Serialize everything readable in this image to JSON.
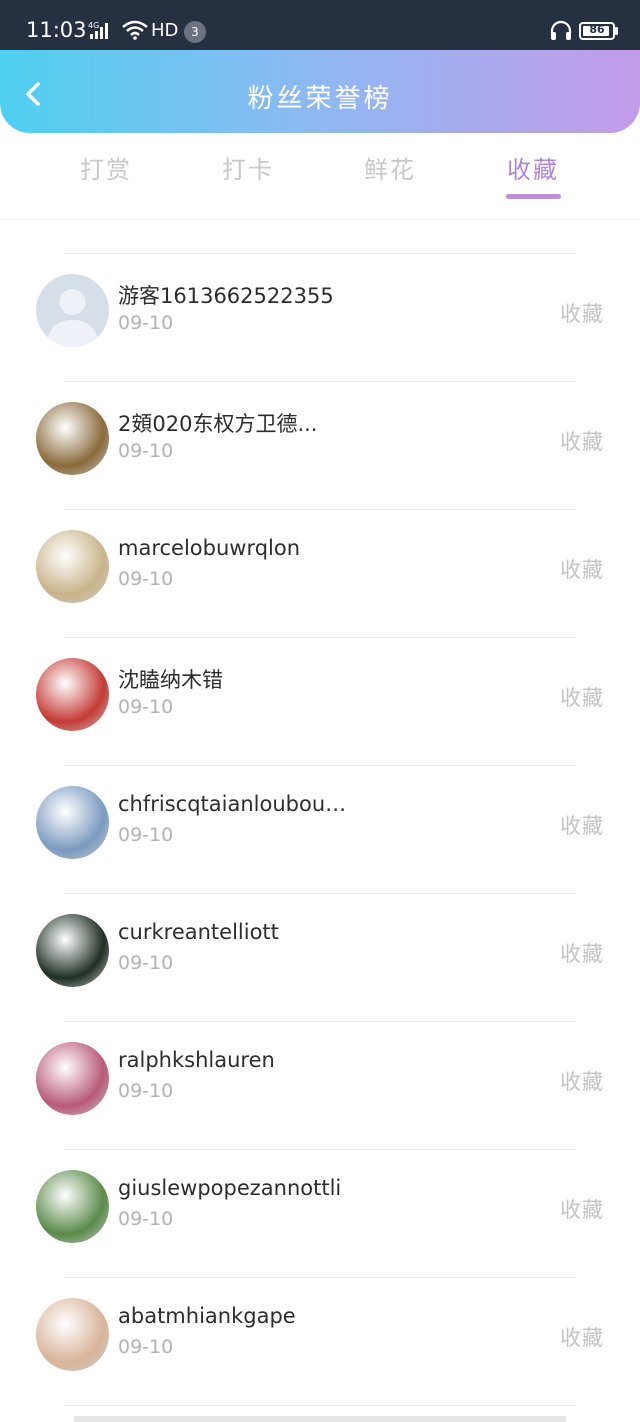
{
  "status_bar": {
    "time": "11:03",
    "network": "4G",
    "hd": "HD",
    "notification_count": "3",
    "battery": "86"
  },
  "header": {
    "title": "粉丝荣誉榜"
  },
  "tabs": [
    {
      "label": "打赏",
      "active": false
    },
    {
      "label": "打卡",
      "active": false
    },
    {
      "label": "鲜花",
      "active": false
    },
    {
      "label": "收藏",
      "active": true
    }
  ],
  "list": {
    "items": [
      {
        "name": "",
        "date": "09-10",
        "action": "收藏",
        "avatar_color": "#9fc4d8"
      },
      {
        "name": "游客1613662522355",
        "date": "09-10",
        "action": "收藏",
        "avatar_color": "#d3dbea"
      },
      {
        "name": "2頞020东权方卫德...",
        "date": "09-10",
        "action": "收藏",
        "avatar_color": "#8a6a3a"
      },
      {
        "name": "marcelobuwrqlon",
        "date": "09-10",
        "action": "收藏",
        "avatar_color": "#c9b48a"
      },
      {
        "name": "沈瞌纳木错",
        "date": "09-10",
        "action": "收藏",
        "avatar_color": "#c43a34"
      },
      {
        "name": "chfriscqtaianlouboutin",
        "date": "09-10",
        "action": "收藏",
        "avatar_color": "#7b9ac0"
      },
      {
        "name": "curkreantelliott",
        "date": "09-10",
        "action": "收藏",
        "avatar_color": "#1f2f24"
      },
      {
        "name": "ralphkshlauren",
        "date": "09-10",
        "action": "收藏",
        "avatar_color": "#b85a78"
      },
      {
        "name": "giuslewpopezannottli",
        "date": "09-10",
        "action": "收藏",
        "avatar_color": "#5a8a4a"
      },
      {
        "name": "abatmhiankgape",
        "date": "09-10",
        "action": "收藏",
        "avatar_color": "#d9b49a"
      }
    ]
  }
}
